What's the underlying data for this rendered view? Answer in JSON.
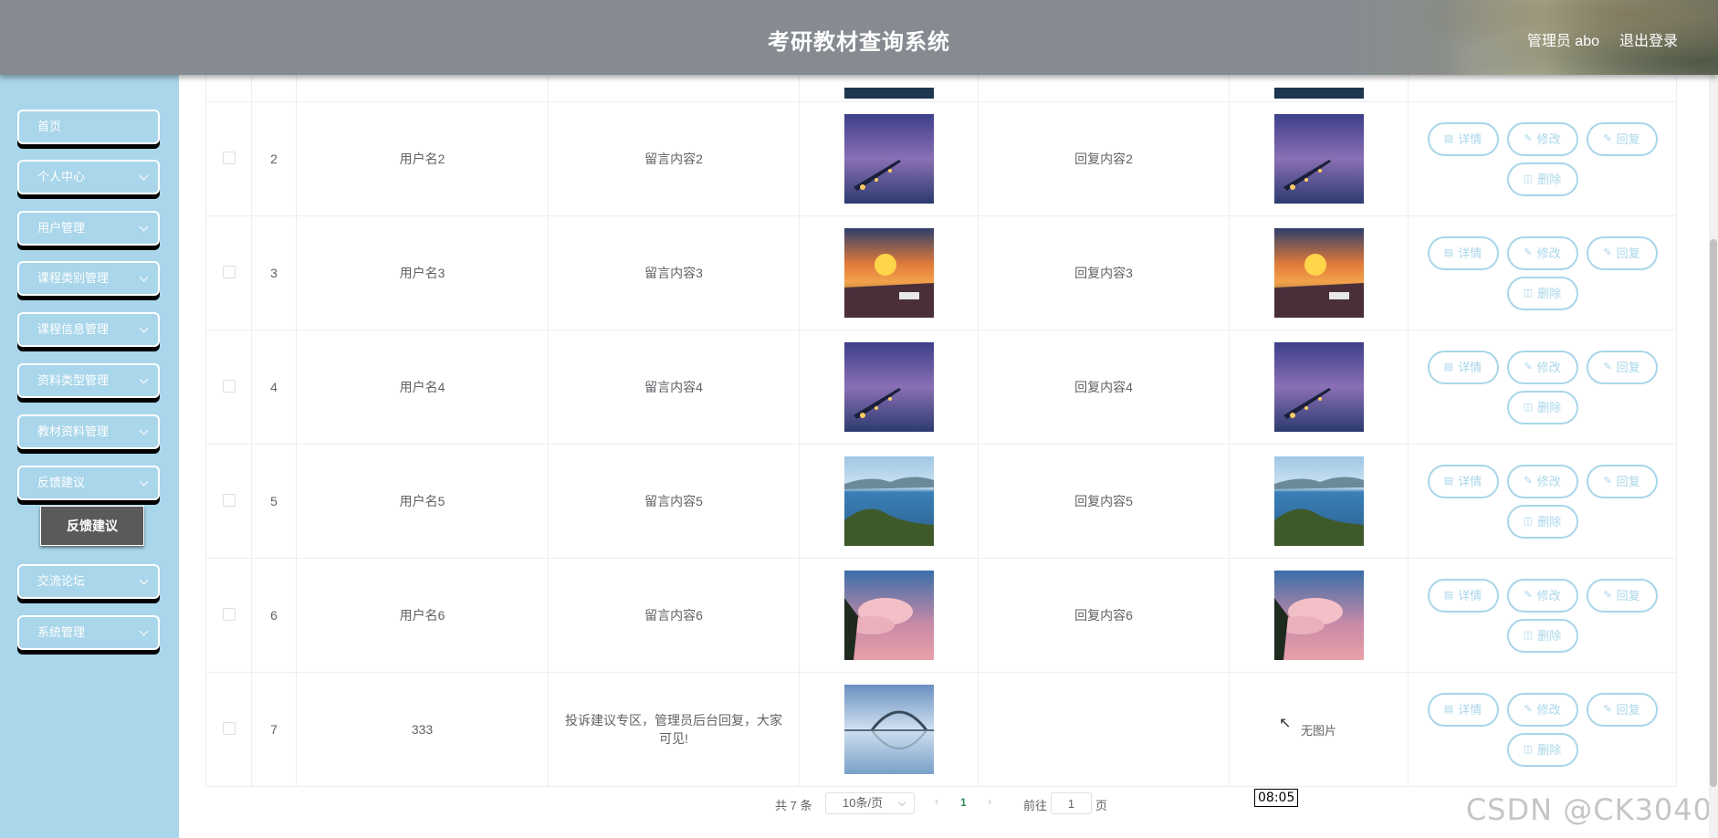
{
  "header": {
    "title": "考研教材查询系统",
    "user": "管理员 abo",
    "logout": "退出登录"
  },
  "sidebar": {
    "items": [
      {
        "label": "首页",
        "expandable": false
      },
      {
        "label": "个人中心",
        "expandable": true
      },
      {
        "label": "用户管理",
        "expandable": true
      },
      {
        "label": "课程类别管理",
        "expandable": true
      },
      {
        "label": "课程信息管理",
        "expandable": true
      },
      {
        "label": "资料类型管理",
        "expandable": true
      },
      {
        "label": "教材资料管理",
        "expandable": true
      },
      {
        "label": "反馈建议",
        "expandable": true
      },
      {
        "label": "交流论坛",
        "expandable": true
      },
      {
        "label": "系统管理",
        "expandable": true
      }
    ],
    "submenu_label": "反馈建议"
  },
  "actions": {
    "detail": "详情",
    "edit": "修改",
    "reply": "回复",
    "delete": "删除"
  },
  "table": {
    "rows": [
      {
        "index": "2",
        "username": "用户名2",
        "message": "留言内容2",
        "reply": "回复内容2",
        "image": "night-pier",
        "reply_image": "night-pier"
      },
      {
        "index": "3",
        "username": "用户名3",
        "message": "留言内容3",
        "reply": "回复内容3",
        "image": "sunset-boat",
        "reply_image": "sunset-boat"
      },
      {
        "index": "4",
        "username": "用户名4",
        "message": "留言内容4",
        "reply": "回复内容4",
        "image": "night-pier",
        "reply_image": "night-pier"
      },
      {
        "index": "5",
        "username": "用户名5",
        "message": "留言内容5",
        "reply": "回复内容5",
        "image": "lake-island",
        "reply_image": "lake-island"
      },
      {
        "index": "6",
        "username": "用户名6",
        "message": "留言内容6",
        "reply": "回复内容6",
        "image": "pink-clouds",
        "reply_image": "pink-clouds"
      },
      {
        "index": "7",
        "username": "333",
        "message": "投诉建议专区，管理员后台回复，大家可见!",
        "reply": "",
        "image": "bridge-reflection",
        "reply_image": null,
        "no_image_label": "无图片"
      }
    ]
  },
  "pagination": {
    "total": "共 7 条",
    "page_size": "10条/页",
    "current_page": "1",
    "goto_label": "前往",
    "goto_value": "1",
    "page_unit": "页"
  },
  "overlay": {
    "time": "08:05",
    "watermark": "CSDN @CK3040"
  },
  "colors": {
    "sidebar": "#a9d6ea",
    "header": "#858b91",
    "accent": "#a9d6ea",
    "submenu": "#5a5a5a"
  }
}
